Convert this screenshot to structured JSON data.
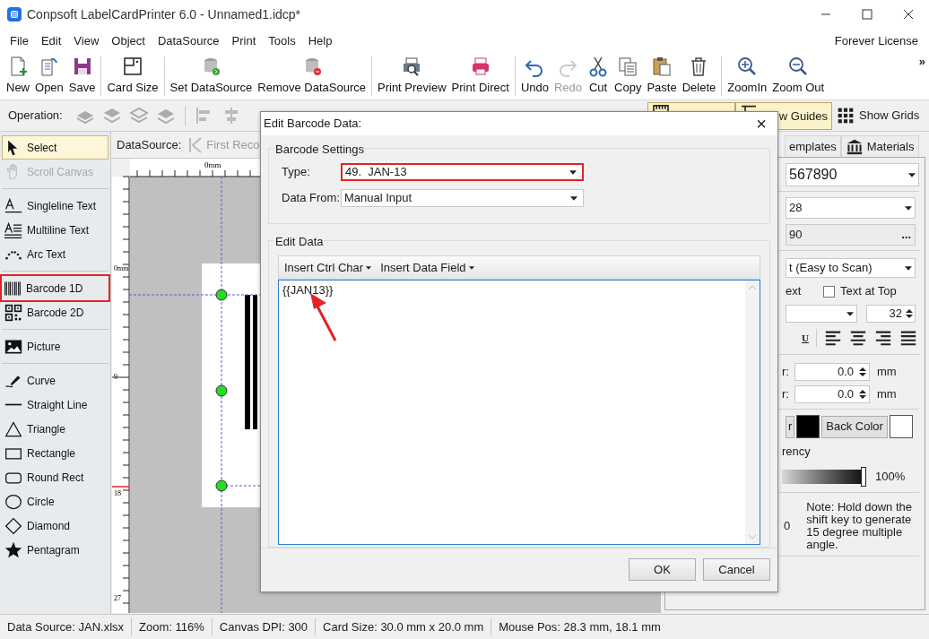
{
  "window": {
    "title": "Conpsoft LabelCardPrinter 6.0 - Unnamed1.idcp*"
  },
  "menu": {
    "items": [
      "File",
      "Edit",
      "View",
      "Object",
      "DataSource",
      "Print",
      "Tools",
      "Help"
    ],
    "license": "Forever License"
  },
  "toolbar": {
    "groups": [
      [
        {
          "label": "New",
          "disabled": false
        },
        {
          "label": "Open",
          "disabled": false
        },
        {
          "label": "Save",
          "disabled": false
        }
      ],
      [
        {
          "label": "Card Size",
          "disabled": false
        }
      ],
      [
        {
          "label": "Set DataSource",
          "disabled": false
        },
        {
          "label": "Remove DataSource",
          "disabled": false
        }
      ],
      [
        {
          "label": "Print Preview",
          "disabled": false
        },
        {
          "label": "Print Direct",
          "disabled": false
        }
      ],
      [
        {
          "label": "Undo",
          "disabled": false
        },
        {
          "label": "Redo",
          "disabled": true
        },
        {
          "label": "Cut",
          "disabled": false
        },
        {
          "label": "Copy",
          "disabled": false
        },
        {
          "label": "Paste",
          "disabled": false
        },
        {
          "label": "Delete",
          "disabled": false
        }
      ],
      [
        {
          "label": "ZoomIn",
          "disabled": false
        },
        {
          "label": "Zoom Out",
          "disabled": false
        }
      ]
    ],
    "overflow": "»"
  },
  "operation_bar": {
    "label": "Operation:",
    "toggles": [
      {
        "on": true
      },
      {
        "label": "w Guides",
        "on": true
      },
      {
        "label": "Show Grids",
        "on": false
      }
    ]
  },
  "tools": {
    "groups": [
      [
        {
          "label": "Select",
          "selected": true,
          "disabled": false,
          "highlighted": false
        },
        {
          "label": "Scroll Canvas",
          "selected": false,
          "disabled": true,
          "highlighted": false
        }
      ],
      [
        {
          "label": "Singleline Text",
          "selected": false,
          "disabled": false,
          "highlighted": false
        },
        {
          "label": "Multiline Text",
          "selected": false,
          "disabled": false,
          "highlighted": false
        },
        {
          "label": "Arc Text",
          "selected": false,
          "disabled": false,
          "highlighted": false
        }
      ],
      [
        {
          "label": "Barcode 1D",
          "selected": false,
          "disabled": false,
          "highlighted": true
        },
        {
          "label": "Barcode 2D",
          "selected": false,
          "disabled": false,
          "highlighted": false
        }
      ],
      [
        {
          "label": "Picture",
          "selected": false,
          "disabled": false,
          "highlighted": false
        }
      ],
      [
        {
          "label": "Curve",
          "selected": false,
          "disabled": false,
          "highlighted": false
        },
        {
          "label": "Straight Line",
          "selected": false,
          "disabled": false,
          "highlighted": false
        },
        {
          "label": "Triangle",
          "selected": false,
          "disabled": false,
          "highlighted": false
        },
        {
          "label": "Rectangle",
          "selected": false,
          "disabled": false,
          "highlighted": false
        },
        {
          "label": "Round Rect",
          "selected": false,
          "disabled": false,
          "highlighted": false
        },
        {
          "label": "Circle",
          "selected": false,
          "disabled": false,
          "highlighted": false
        },
        {
          "label": "Diamond",
          "selected": false,
          "disabled": false,
          "highlighted": false
        },
        {
          "label": "Pentagram",
          "selected": false,
          "disabled": false,
          "highlighted": false
        }
      ]
    ]
  },
  "datasource_bar": {
    "label": "DataSource:",
    "first_record": "First Reco"
  },
  "rulers": {
    "top_labels": [
      "0mm"
    ],
    "left_labels": [
      "0mm",
      "9",
      "18",
      "27"
    ]
  },
  "dialog": {
    "title": "Edit Barcode Data:",
    "close": "×",
    "barcode_settings": {
      "title": "Barcode Settings",
      "type_label": "Type:",
      "type_value": "49.  JAN-13",
      "type_highlighted": true,
      "data_from_label": "Data From:",
      "data_from_value": "Manual Input"
    },
    "edit_data": {
      "title": "Edit Data",
      "menus": [
        "Insert Ctrl Char",
        "Insert Data Field"
      ],
      "value": "{{JAN13}}"
    },
    "buttons": [
      "OK",
      "Cancel"
    ]
  },
  "right_panel": {
    "tabs": [
      {
        "label": "emplates",
        "selected": false
      },
      {
        "label": "Materials",
        "selected": false
      }
    ],
    "data_dropdown": "567890",
    "symbology_dropdown": "28",
    "data_field": "90",
    "browse_button": "...",
    "text_mode_dropdown": "t (Easy to Scan)",
    "show_text_label": "ext",
    "text_at_top": {
      "label": "Text at Top",
      "checked": false
    },
    "font_size": "32",
    "underline": "U",
    "offsets": [
      {
        "label": "r:",
        "value": "0.0",
        "unit": "mm"
      },
      {
        "label": "r:",
        "value": "0.0",
        "unit": "mm"
      }
    ],
    "colors": [
      {
        "label": "r",
        "color": "#000000"
      },
      {
        "label": "Back Color",
        "color": "#ffffff"
      }
    ],
    "transparency_label": "rency",
    "transparency": {
      "level": 1.0
    },
    "transparency_reading": "100%",
    "angle_value": "0",
    "note": "Note: Hold down the shift key to generate 15 degree multiple angle."
  },
  "status_bar": [
    "Data Source: JAN.xlsx",
    "Zoom: 116%",
    "Canvas DPI: 300",
    "Card Size: 30.0 mm x 20.0 mm",
    "Mouse Pos: 28.3 mm, 18.1 mm"
  ]
}
